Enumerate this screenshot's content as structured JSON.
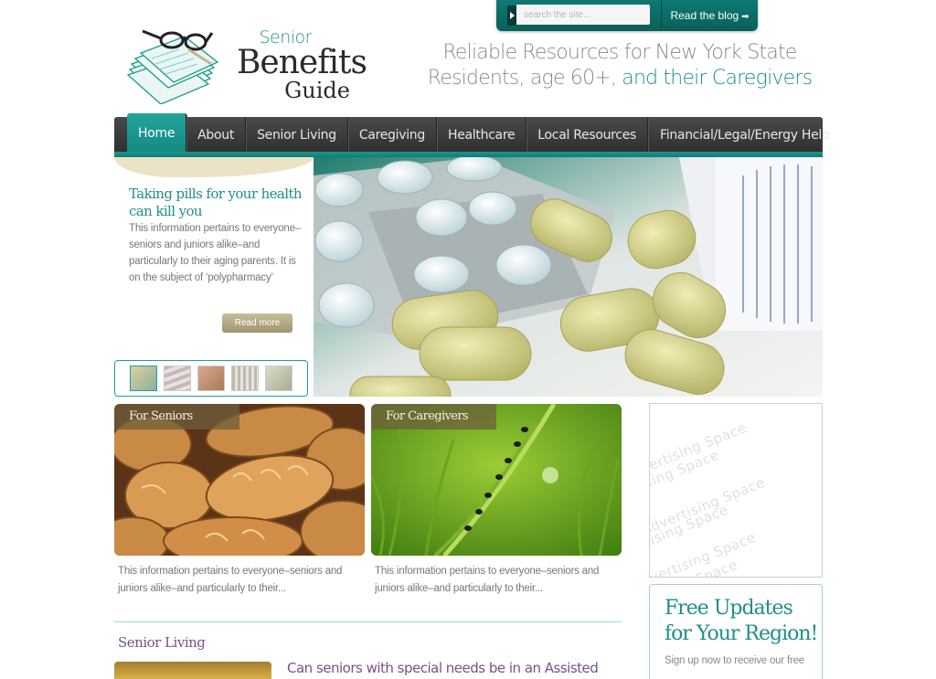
{
  "header": {
    "logo": {
      "line1": "Senior",
      "line2": "Benefits",
      "line3": "Guide"
    },
    "search": {
      "placeholder": "search the site..."
    },
    "blog_button": "Read the blog",
    "tagline": {
      "part1": "Reliable Resources for New York State Residents, age 60+,",
      "part2": " and their Caregivers"
    }
  },
  "nav": {
    "items": [
      {
        "label": "Home",
        "active": true
      },
      {
        "label": "About"
      },
      {
        "label": "Senior Living"
      },
      {
        "label": "Caregiving"
      },
      {
        "label": "Healthcare"
      },
      {
        "label": "Local Resources"
      },
      {
        "label": "Financial/Legal/Energy Help"
      }
    ]
  },
  "feature": {
    "title": "Taking pills for your health can kill you",
    "text": "This information pertains to everyone–seniors and juniors alike–and particularly to their aging parents. It is on the subject of ‘polypharmacy’",
    "read_more": "Read more",
    "image_label": "pills-photo",
    "thumbnails": [
      "pills-thumb",
      "flag-thumb",
      "hands-thumb",
      "building-thumb",
      "money-thumb"
    ]
  },
  "cards": [
    {
      "label": "For Seniors",
      "text": "This information pertains to everyone–seniors and juniors alike–and particularly to their..."
    },
    {
      "label": "For Caregivers",
      "text": "This information pertains to everyone–seniors and juniors alike–and particularly to their..."
    }
  ],
  "section": {
    "title": "Senior Living",
    "article_title": "Can seniors with special needs be in an Assisted"
  },
  "sidebar": {
    "ad_text": "Advertising Space",
    "updates_title": "Free Updates for Your Region!",
    "updates_text": "Sign up now to receive our free"
  },
  "colors": {
    "teal": "#1f8f88",
    "nav_dark": "#3a3a3a",
    "purple": "#7a4f8a",
    "tan": "#b3a985"
  }
}
